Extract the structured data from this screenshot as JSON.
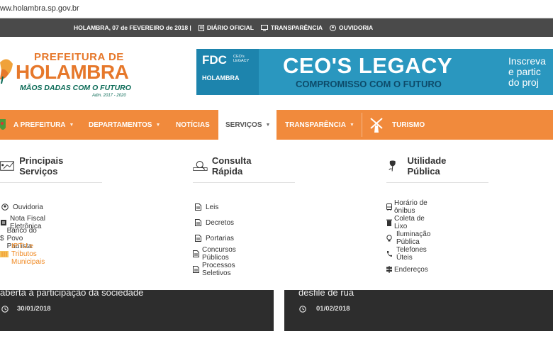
{
  "browser": {
    "url": "ww.holambra.sp.gov.br"
  },
  "topbar": {
    "date": "HOLAMBRA, 07 de FEVEREIRO de 2018 |",
    "diario": "DIÁRIO OFICIAL",
    "transparencia": "TRANSPARÊNCIA",
    "ouvidoria": "OUVIDORIA"
  },
  "logo": {
    "line1": "PREFEITURA DE",
    "line2": "HOLAMBRA",
    "line3": "MÃOS DADAS COM O FUTURO",
    "line4": "Adm. 2017 - 2020"
  },
  "banner": {
    "fdc": "FDC",
    "ceo_small": "CEO's LEGACY",
    "small_logo": "HOLAMBRA",
    "title": "CEO'S LEGACY",
    "subtitle": "COMPROMISSO COM O FUTURO",
    "side": [
      "Inscreva",
      "e partic",
      "do proj"
    ]
  },
  "nav": {
    "items": [
      {
        "label": "A PREFEITURA",
        "dropdown": true
      },
      {
        "label": "DEPARTAMENTOS",
        "dropdown": true
      },
      {
        "label": "NOTÍCIAS",
        "dropdown": false
      },
      {
        "label": "SERVIÇOS",
        "dropdown": true,
        "active": true
      },
      {
        "label": "TRANSPARÊNCIA",
        "dropdown": true
      },
      {
        "label": "TURISMO",
        "dropdown": false
      }
    ]
  },
  "mega": {
    "col1": {
      "title": "Principais Serviços",
      "items": [
        "Ouvidoria",
        "Nota Fiscal Eletrônica",
        "Banco do Povo Paulista",
        "IPTU e Tributos Municipais"
      ]
    },
    "col2": {
      "title": "Consulta Rápida",
      "items": [
        "Leis",
        "Decretos",
        "Portarias",
        "Concursos Públicos",
        "Processos Seletivos"
      ]
    },
    "col3": {
      "title": "Utilidade Pública",
      "items": [
        "Horário de ônibus",
        "Coleta de Lixo",
        "Iluminação Pública",
        "Telefones Úteis",
        "Endereços"
      ]
    }
  },
  "posts": [
    {
      "title": "aberta à participação da sociedade",
      "date": "30/01/2018"
    },
    {
      "title": "desfile de rua",
      "date": "01/02/2018"
    }
  ],
  "colors": {
    "orange": "#f18a3c",
    "highlight": "#f08a24",
    "topbar": "#4a4a4a",
    "banner": "#2a97bf"
  }
}
